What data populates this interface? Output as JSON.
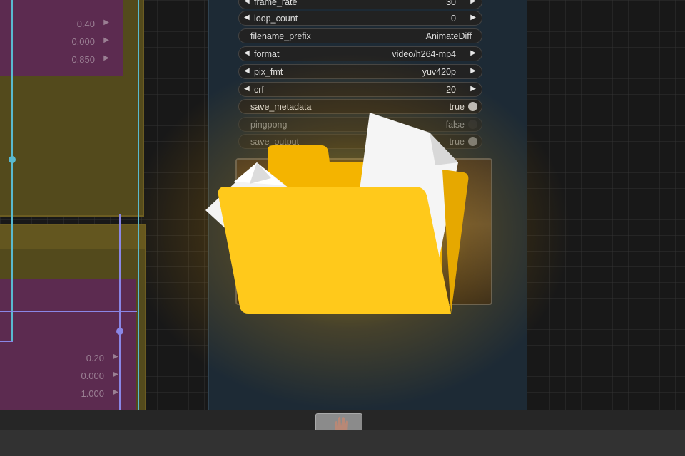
{
  "left_node_top": {
    "widgets": [
      {
        "value": "0.40"
      },
      {
        "value": "0.000"
      },
      {
        "value": "0.850"
      }
    ]
  },
  "left_node_bottom": {
    "widgets": [
      {
        "value": "0.20"
      },
      {
        "value": "0.000"
      },
      {
        "value": "1.000"
      }
    ]
  },
  "video_combine": {
    "rows": [
      {
        "label": "frame_rate",
        "value": "30",
        "type": "number"
      },
      {
        "label": "loop_count",
        "value": "0",
        "type": "number"
      },
      {
        "label": "filename_prefix",
        "value": "AnimateDiff",
        "type": "text"
      },
      {
        "label": "format",
        "value": "video/h264-mp4",
        "type": "combo"
      },
      {
        "label": "pix_fmt",
        "value": "yuv420p",
        "type": "combo"
      },
      {
        "label": "crf",
        "value": "20",
        "type": "number"
      },
      {
        "label": "save_metadata",
        "value": "true",
        "type": "toggle"
      },
      {
        "label": "pingpong",
        "value": "false",
        "type": "toggle"
      },
      {
        "label": "save_output",
        "value": "true",
        "type": "toggle"
      }
    ]
  },
  "icons": {
    "arrow_left": "◀",
    "arrow_right": "▶",
    "overlay": "open-folder-icon"
  },
  "colors": {
    "folder": "#FFC91B",
    "folder_back": "#F4B400",
    "glow": "#FFC400",
    "wire_cyan": "#59B9CF",
    "wire_purple": "#8A86E6",
    "node_magenta": "#5C2B50",
    "node_olive": "#534A1C",
    "node_blue": "#1D2A35"
  }
}
